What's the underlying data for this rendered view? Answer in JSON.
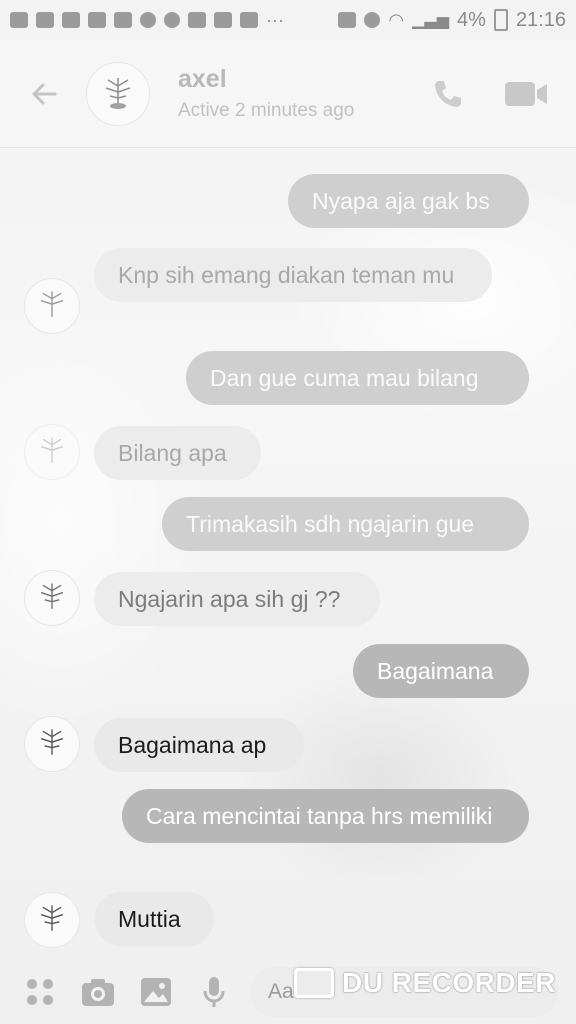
{
  "status_bar": {
    "battery": "4%",
    "time": "21:16"
  },
  "header": {
    "name": "axel",
    "status": "Active 2 minutes ago"
  },
  "messages": [
    {
      "side": "out",
      "text": "Nyapa aja gak bs"
    },
    {
      "side": "in",
      "text": "Knp sih emang diakan teman mu"
    },
    {
      "side": "out",
      "text": "Dan gue cuma mau bilang"
    },
    {
      "side": "in",
      "text": "Bilang apa"
    },
    {
      "side": "out",
      "text": "Trimakasih sdh ngajarin gue"
    },
    {
      "side": "in",
      "text": "Ngajarin apa sih gj ??"
    },
    {
      "side": "out",
      "text": "Bagaimana"
    },
    {
      "side": "in",
      "text": "Bagaimana ap"
    },
    {
      "side": "out",
      "text": "Cara mencintai tanpa hrs memiliki"
    },
    {
      "side": "in",
      "text": "Muttia"
    }
  ],
  "composer": {
    "placeholder": "Aa"
  },
  "watermark": "DU RECORDER",
  "icons": {
    "back": "back-arrow-icon",
    "call": "phone-icon",
    "video": "video-call-icon",
    "apps": "apps-grid-icon",
    "camera": "camera-icon",
    "gallery": "image-icon",
    "voice": "microphone-icon"
  }
}
